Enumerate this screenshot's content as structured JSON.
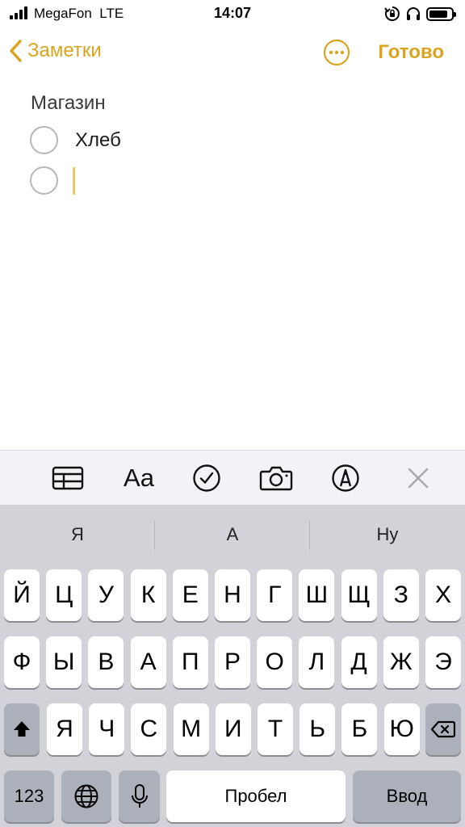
{
  "status_bar": {
    "carrier": "MegaFon",
    "network": "LTE",
    "time": "14:07",
    "battery_level": 0.85
  },
  "nav": {
    "back_label": "Заметки",
    "done_label": "Готово",
    "accent_color": "#d9a520"
  },
  "note": {
    "title": "Магазин",
    "items": [
      {
        "text": "Хлеб",
        "checked": false
      },
      {
        "text": "",
        "checked": false
      }
    ]
  },
  "toolbar": {
    "format_label": "Aa",
    "icons": [
      "table-icon",
      "format-text-icon",
      "checklist-icon",
      "camera-icon",
      "markup-pen-icon",
      "close-icon"
    ]
  },
  "keyboard": {
    "suggestions": [
      "Я",
      "А",
      "Ну"
    ],
    "row1": [
      "Й",
      "Ц",
      "У",
      "К",
      "Е",
      "Н",
      "Г",
      "Ш",
      "Щ",
      "З",
      "Х"
    ],
    "row2": [
      "Ф",
      "Ы",
      "В",
      "А",
      "П",
      "Р",
      "О",
      "Л",
      "Д",
      "Ж",
      "Э"
    ],
    "row3": [
      "Я",
      "Ч",
      "С",
      "М",
      "И",
      "Т",
      "Ь",
      "Б",
      "Ю"
    ],
    "numbers_label": "123",
    "space_label": "Пробел",
    "return_label": "Ввод"
  }
}
